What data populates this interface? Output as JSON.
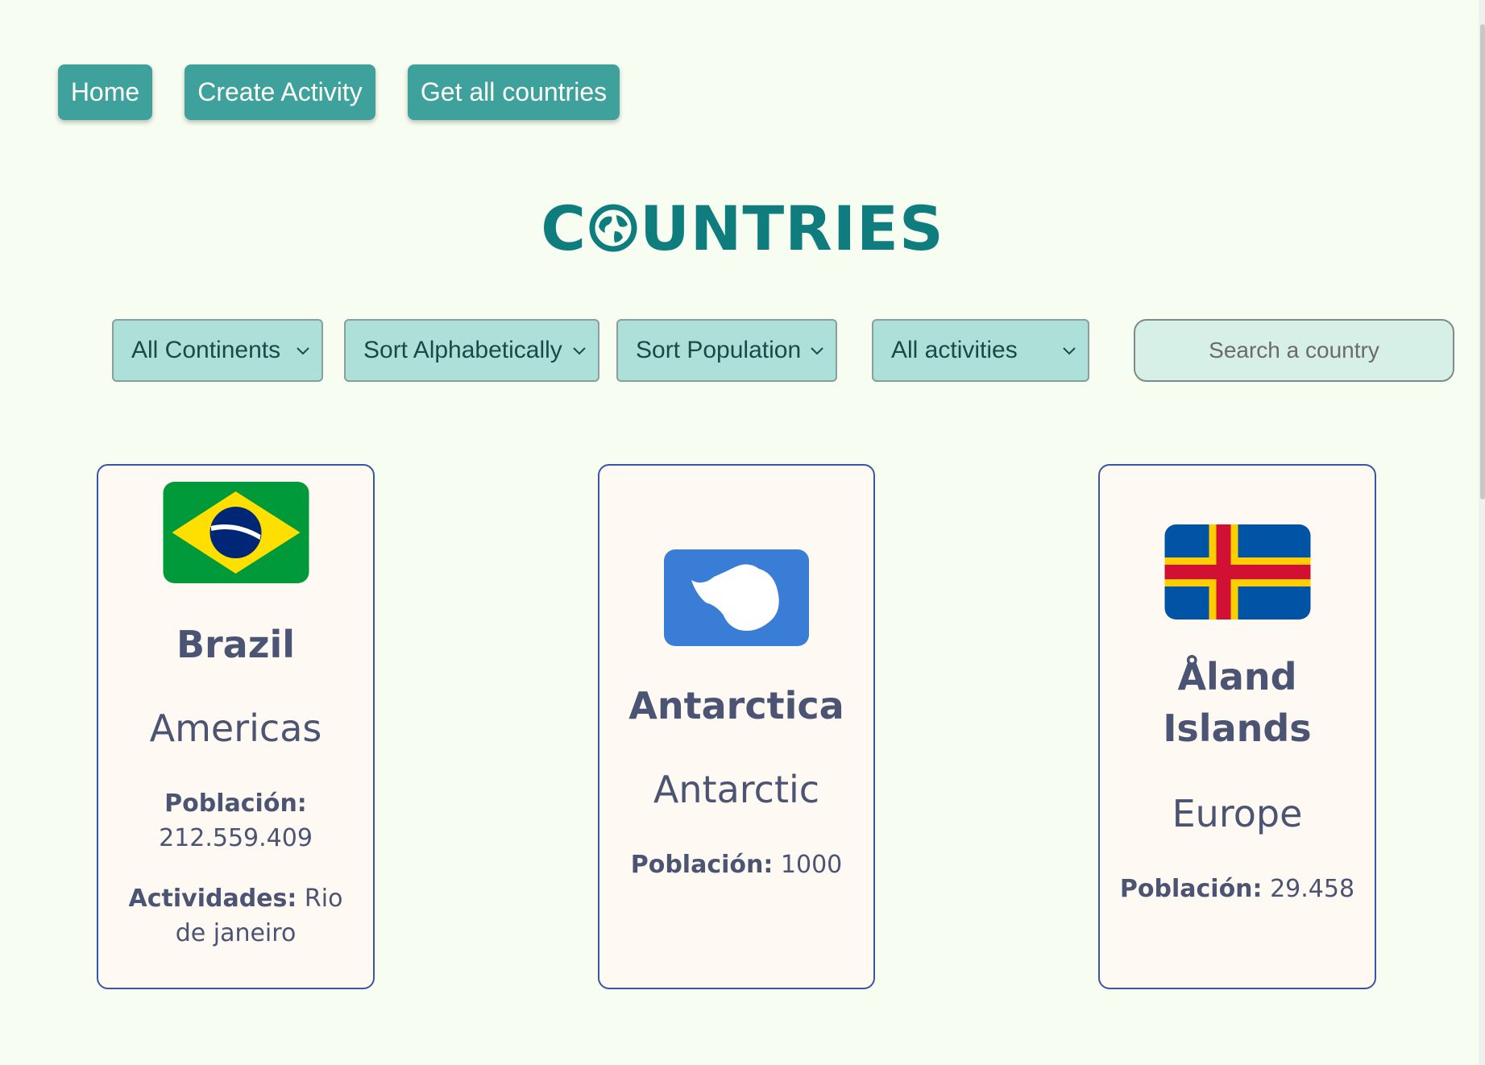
{
  "nav": {
    "home": "Home",
    "create_activity": "Create Activity",
    "get_all": "Get all countries"
  },
  "title": {
    "before": "C",
    "after": "UNTRIES"
  },
  "filters": {
    "continents": "All Continents",
    "alphabetical": "Sort Alphabetically",
    "population": "Sort Population",
    "activities": "All activities",
    "search_placeholder": "Search a country"
  },
  "cards": [
    {
      "name": "Brazil",
      "continent": "Americas",
      "population_label": "Población:",
      "population": "212.559.409",
      "activities_label": "Actividades:",
      "activities": "Rio de janeiro"
    },
    {
      "name": "Antarctica",
      "continent": "Antarctic",
      "population_label": "Población:",
      "population": "1000"
    },
    {
      "name": "Åland Islands",
      "continent": "Europe",
      "population_label": "Población:",
      "population": "29.458"
    }
  ],
  "colors": {
    "background": "#f8fdf1",
    "nav_button": "#3fa19b",
    "title": "#0f7c7d",
    "select": "#aee0da",
    "card_border": "#3a55a8",
    "card_text": "#4c5474"
  }
}
